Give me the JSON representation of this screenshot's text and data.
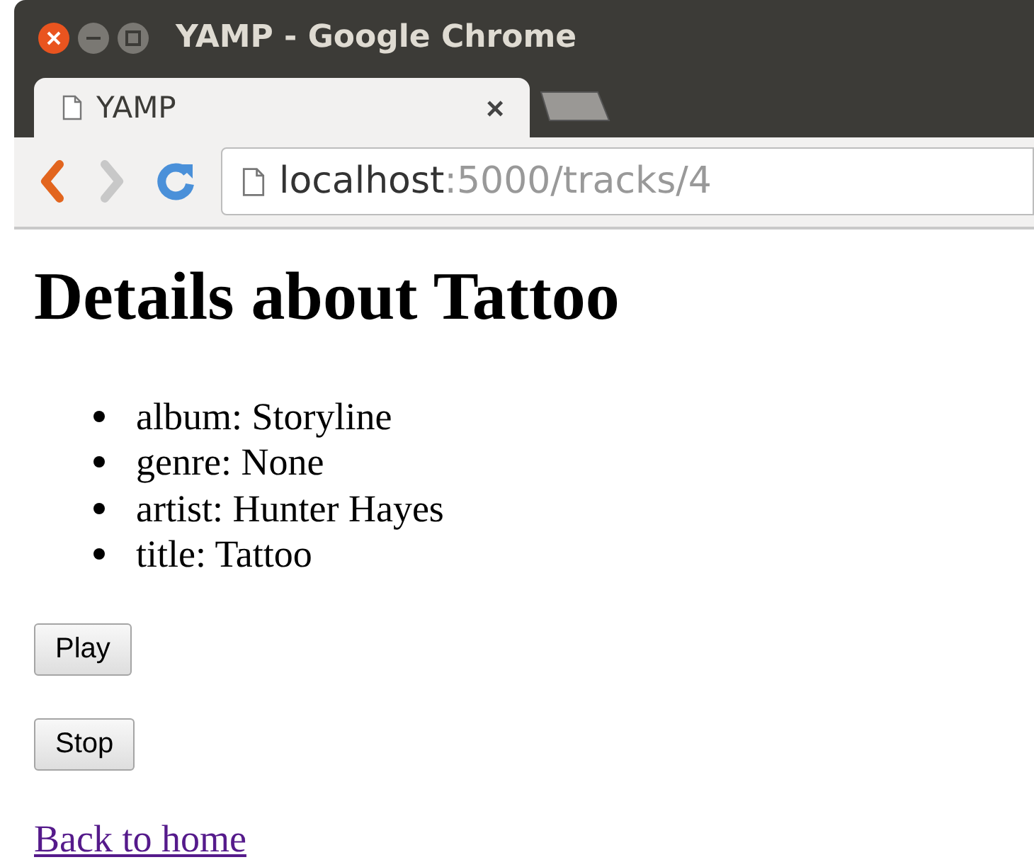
{
  "window": {
    "title": "YAMP - Google Chrome"
  },
  "tabs": [
    {
      "label": "YAMP",
      "close": "×",
      "selected": true
    }
  ],
  "address": {
    "host": "localhost",
    "path": ":5000/tracks/4"
  },
  "page": {
    "heading": "Details about Tattoo",
    "details": [
      "album: Storyline",
      "genre: None",
      "artist: Hunter Hayes",
      "title: Tattoo"
    ],
    "buttons": [
      "Play",
      "Stop"
    ],
    "link": "Back to home"
  }
}
